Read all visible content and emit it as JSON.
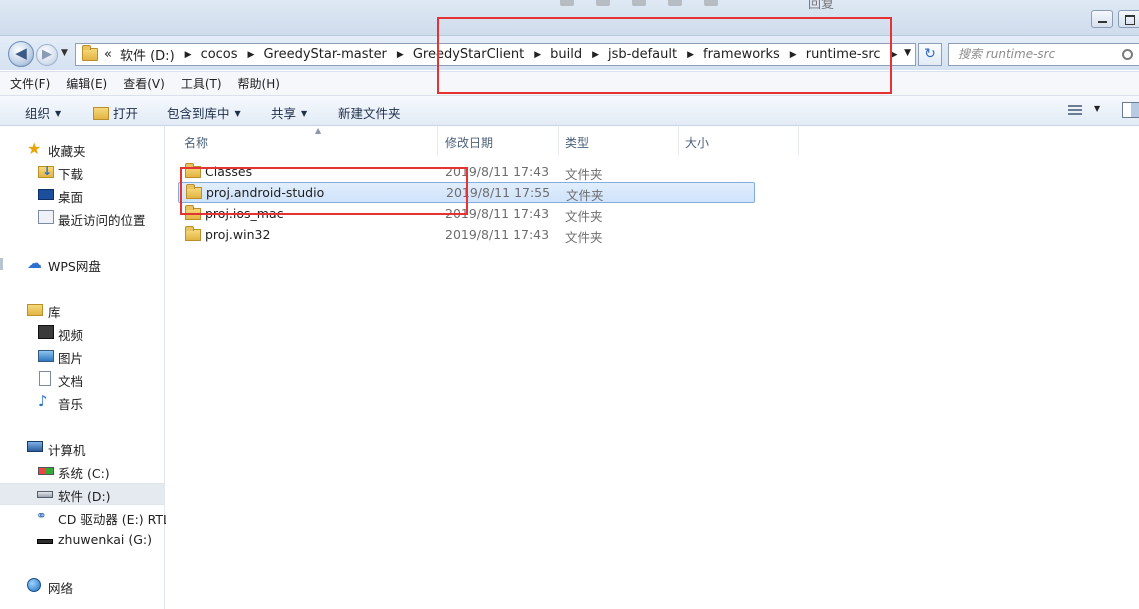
{
  "window": {
    "ghost_toolbar_label": "回复"
  },
  "navigation": {
    "back_glyph": "◀",
    "forward_glyph": "▶",
    "overflow": "«",
    "breadcrumbs": [
      "软件 (D:)",
      "cocos",
      "GreedyStar-master",
      "GreedyStarClient",
      "build",
      "jsb-default",
      "frameworks",
      "runtime-src"
    ],
    "search_placeholder": "搜索 runtime-src"
  },
  "menu": [
    "文件(F)",
    "编辑(E)",
    "查看(V)",
    "工具(T)",
    "帮助(H)"
  ],
  "commands": {
    "organize": "组织",
    "open": "打开",
    "include_in_library": "包含到库中",
    "share": "共享",
    "new_folder": "新建文件夹"
  },
  "sidebar": {
    "favorites": "收藏夹",
    "downloads": "下载",
    "desktop": "桌面",
    "recent": "最近访问的位置",
    "wps": "WPS网盘",
    "libraries": "库",
    "videos": "视频",
    "pictures": "图片",
    "documents": "文档",
    "music": "音乐",
    "computer": "计算机",
    "drive_c": "系统 (C:)",
    "drive_d": "软件 (D:)",
    "drive_e": "CD 驱动器 (E:) RTL_",
    "drive_g": "zhuwenkai (G:)",
    "network": "网络"
  },
  "columns": {
    "name": "名称",
    "date": "修改日期",
    "type": "类型",
    "size": "大小"
  },
  "files": [
    {
      "name": "Classes",
      "date": "2019/8/11 17:43",
      "type": "文件夹",
      "selected": false
    },
    {
      "name": "proj.android-studio",
      "date": "2019/8/11 17:55",
      "type": "文件夹",
      "selected": true
    },
    {
      "name": "proj.ios_mac",
      "date": "2019/8/11 17:43",
      "type": "文件夹",
      "selected": false
    },
    {
      "name": "proj.win32",
      "date": "2019/8/11 17:43",
      "type": "文件夹",
      "selected": false
    }
  ],
  "annotation_color": "#e53333",
  "selection_color": "#cfe3fb"
}
